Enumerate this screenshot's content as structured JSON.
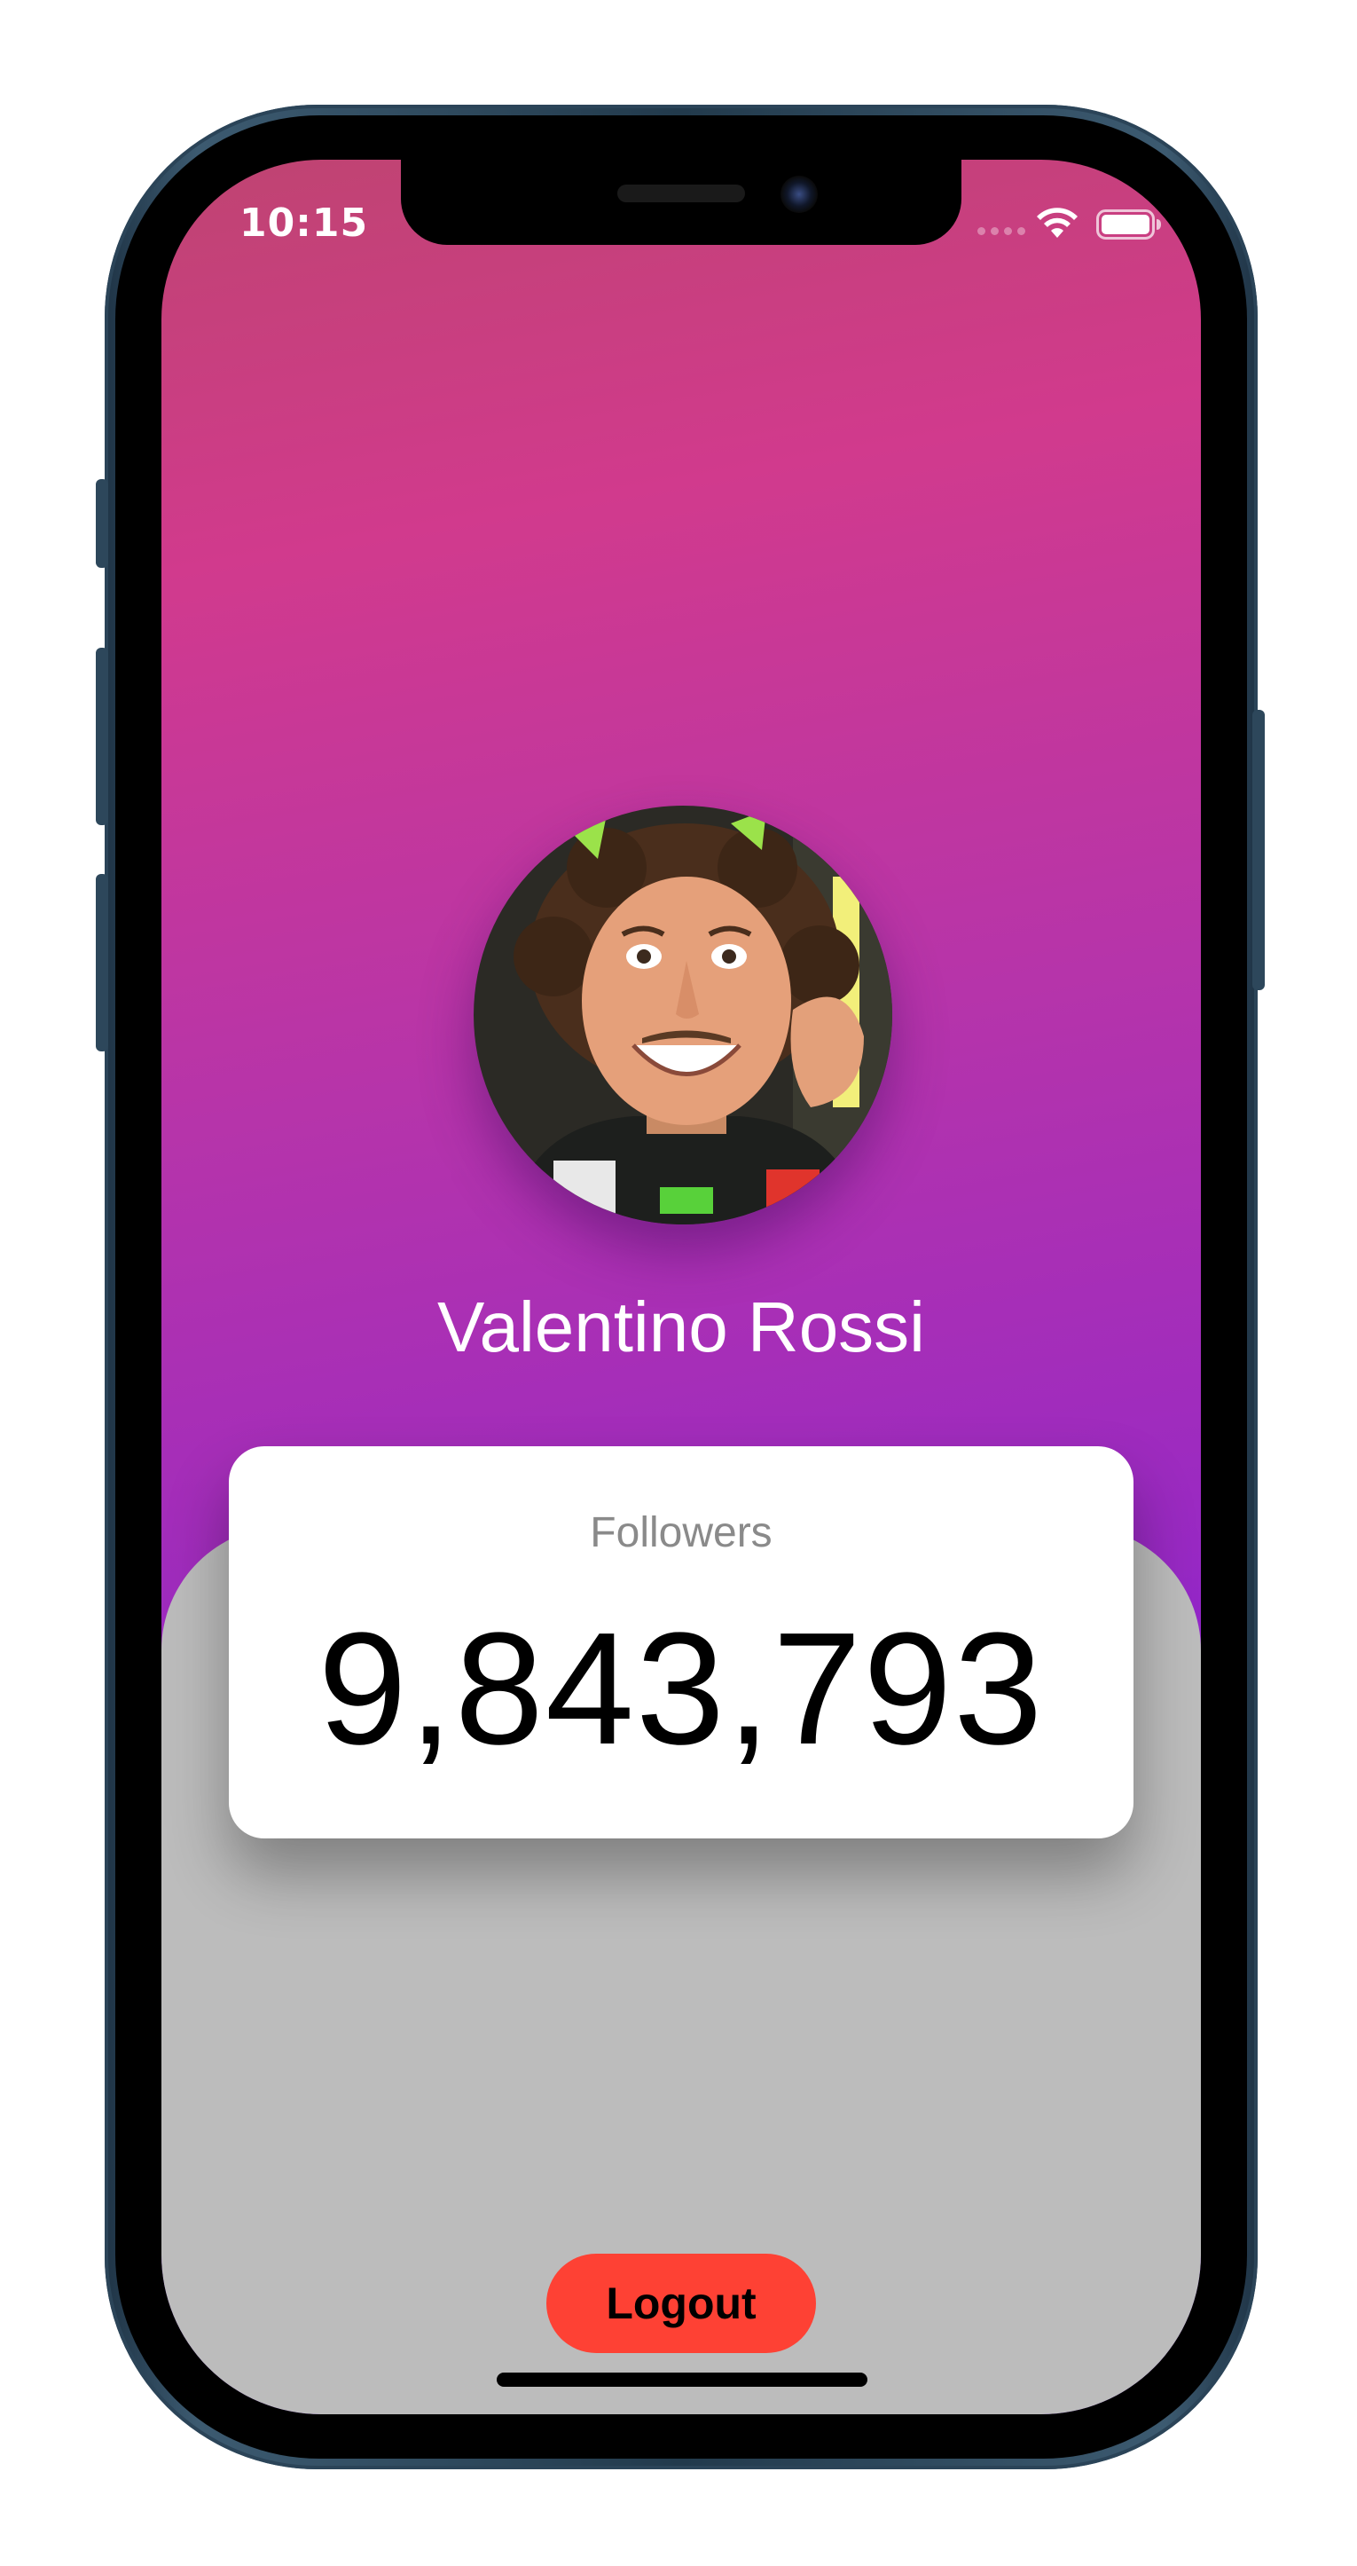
{
  "status_bar": {
    "time": "10:15",
    "icons": [
      "cellular-signal-icon",
      "wifi-icon",
      "battery-icon"
    ]
  },
  "profile": {
    "name": "Valentino Rossi",
    "avatar": "profile-photo"
  },
  "stats": {
    "label": "Followers",
    "count": "9,843,793"
  },
  "actions": {
    "logout_label": "Logout"
  },
  "colors": {
    "gradient_top": "#bf4471",
    "gradient_mid": "#d13a8d",
    "gradient_bottom": "#6d18df",
    "panel": "#bcbcbc",
    "logout_button": "#fe4134",
    "card": "#ffffff"
  }
}
